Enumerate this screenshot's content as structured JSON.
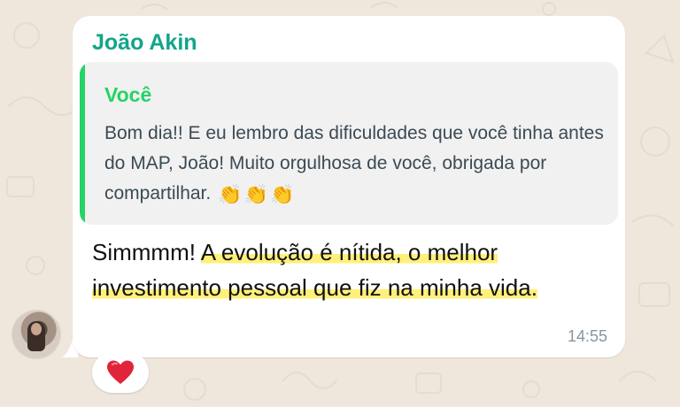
{
  "chat": {
    "background_color": "#efe7dc",
    "bubble_color": "#ffffff"
  },
  "message": {
    "sender_name": "João Akin",
    "sender_color": "#12a58a",
    "quoted": {
      "author": "Você",
      "author_color": "#25d366",
      "text": "Bom dia!! E eu lembro das dificuldades que você tinha antes do MAP, João! Muito orgulhosa de você, obrigada por compartilhar.",
      "emoji": "👏👏👏"
    },
    "text_plain": "Simmmm! ",
    "text_highlighted": "A evolução é nítida, o melhor investimento pessoal que fiz na minha vida.",
    "highlight_color": "#fff07a",
    "time": "14:55"
  },
  "reaction": {
    "icon": "heart-icon",
    "color": "#e0243a"
  },
  "avatar": {
    "icon": "contact-avatar"
  }
}
